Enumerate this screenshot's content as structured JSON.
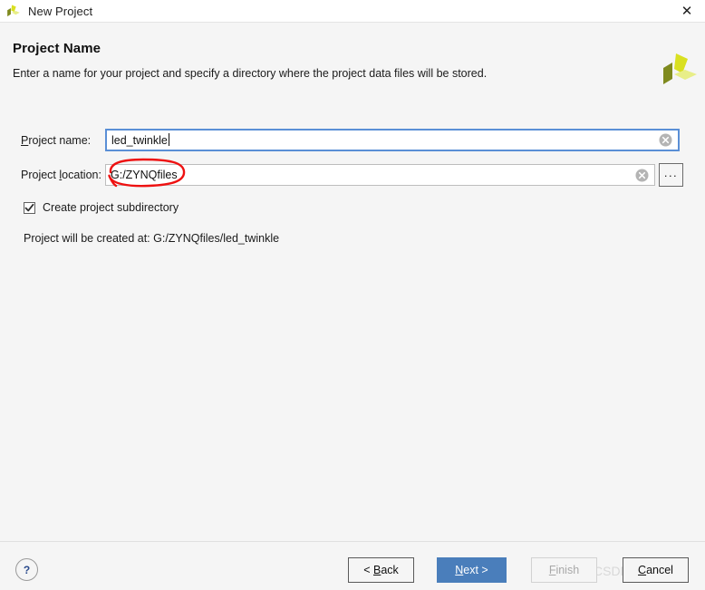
{
  "titlebar": {
    "title": "New Project",
    "logo_icon": "vivado-logo-icon",
    "close_icon": "close-icon"
  },
  "header": {
    "title": "Project Name",
    "subtitle": "Enter a name for your project and specify a directory where the project data files will be stored.",
    "logo_icon": "vivado-logo-icon"
  },
  "form": {
    "project_name": {
      "label_prefix": "P",
      "label_accel": "",
      "label": "Project name:",
      "value": "led_twinkle",
      "placeholder": "",
      "clear_icon": "clear-circle-icon"
    },
    "project_location": {
      "label": "Project location:",
      "value": "G:/ZYNQfiles",
      "placeholder": "",
      "clear_icon": "clear-circle-icon",
      "browse_label": "...",
      "browse_icon": "ellipsis-icon"
    },
    "create_subdirectory": {
      "label": "Create project subdirectory",
      "checked": true,
      "check_icon": "checkmark-icon"
    },
    "created_at_text": "Project will be created at: G:/ZYNQfiles/led_twinkle"
  },
  "annotation": {
    "shape": "red-ellipse-highlight",
    "color": "#ee1111",
    "target": "G:/ZYNQfiles"
  },
  "footer": {
    "help_label": "?",
    "help_icon": "help-question-icon",
    "back_label": "< Back",
    "next_label": "Next >",
    "finish_label": "Finish",
    "cancel_label": "Cancel"
  },
  "watermark": {
    "text": "CSDN @百岸贤"
  },
  "colors": {
    "primary_button": "#4a7ebb",
    "focus_border": "#5a8fd6",
    "annotation_red": "#ee1111",
    "background": "#f5f5f5",
    "logo_dark": "#7f8a1e",
    "logo_mid": "#d9e021",
    "logo_light": "#e8ee88"
  }
}
